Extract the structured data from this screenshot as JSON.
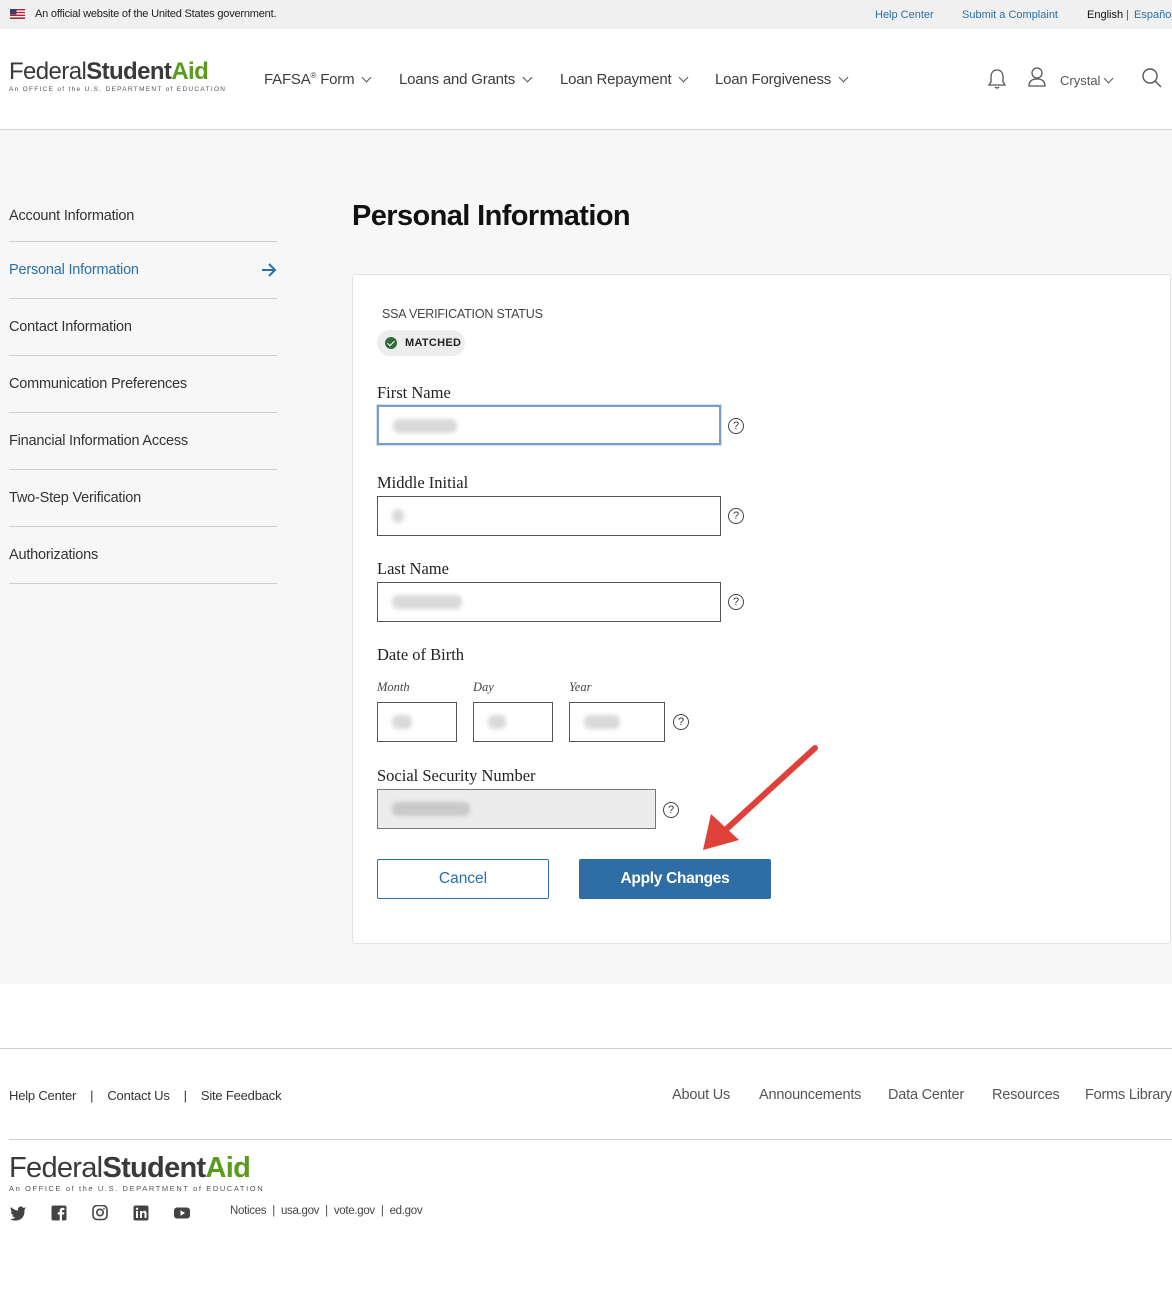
{
  "gov_banner": {
    "official_text": "An official website of the United States government.",
    "help_center": "Help Center",
    "submit_complaint": "Submit a Complaint",
    "lang_english": "English",
    "lang_separator": "|",
    "lang_espanol": "Español"
  },
  "header": {
    "logo": {
      "federal": "Federal",
      "student": "Student",
      "aid": "Aid",
      "subtitle": "An OFFICE of the U.S. DEPARTMENT of EDUCATION"
    },
    "nav": {
      "fafsa": "FAFSA",
      "fafsa_sup": "®",
      "fafsa_suffix": "Form",
      "loans_grants": "Loans and Grants",
      "loan_repayment": "Loan Repayment",
      "loan_forgiveness": "Loan Forgiveness"
    },
    "user_name": "Crystal"
  },
  "sidenav": {
    "items": [
      {
        "label": "Account Information"
      },
      {
        "label": "Personal Information"
      },
      {
        "label": "Contact Information"
      },
      {
        "label": "Communication Preferences"
      },
      {
        "label": "Financial Information Access"
      },
      {
        "label": "Two-Step Verification"
      },
      {
        "label": "Authorizations"
      }
    ]
  },
  "page": {
    "title": "Personal Information",
    "ssa_label": "SSA VERIFICATION STATUS",
    "ssa_badge": "MATCHED",
    "first_name_label": "First Name",
    "middle_initial_label": "Middle Initial",
    "last_name_label": "Last Name",
    "dob_label": "Date of Birth",
    "dob_month": "Month",
    "dob_day": "Day",
    "dob_year": "Year",
    "ssn_label": "Social Security Number",
    "help_glyph": "?",
    "cancel": "Cancel",
    "apply": "Apply Changes"
  },
  "footer": {
    "help_center": "Help Center",
    "contact_us": "Contact Us",
    "site_feedback": "Site Feedback",
    "bar": "|",
    "about_us": "About Us",
    "announcements": "Announcements",
    "data_center": "Data Center",
    "resources": "Resources",
    "forms_library": "Forms Library",
    "notices": "Notices",
    "usagov": "usa.gov",
    "votegov": "vote.gov",
    "edgov": "ed.gov",
    "sep": "|"
  },
  "colors": {
    "accent": "#2f6ea5",
    "link": "#2a6fa8",
    "aid_green": "#5a9a1c",
    "annotation": "#e0403a"
  }
}
